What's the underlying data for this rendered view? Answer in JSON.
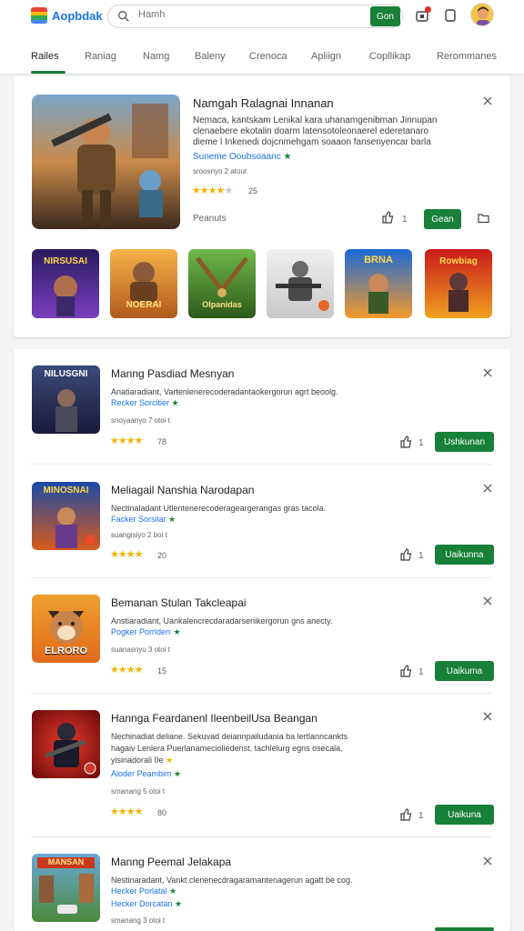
{
  "header": {
    "logo_text": "Aopbdak",
    "search_placeholder": "Hamh",
    "search_button": "Gon",
    "logo_colors": [
      "#ea4335",
      "#fbbc04",
      "#34a853",
      "#4285f4"
    ]
  },
  "tabs": [
    "Railes",
    "Raniag",
    "Namg",
    "Baleny",
    "Crenoca",
    "Apliign",
    "Copllikap",
    "Rerommanes"
  ],
  "featured": {
    "title": "Namgah Ralagnai Innanan",
    "description": [
      "Nemaca, kantskam Lenikal kara uhanamgenibman Jinnupan",
      "clenaebere ekotalin doarm latensotoleonaerel ederetanaro",
      "dieme l Inkenedi dojcnmehgam soaaon fansenyencar barla"
    ],
    "developer": "Suneme Ooubsoaanc",
    "meta": "sroosnyo 2 atout",
    "rating": "25",
    "price_label": "Peanuts",
    "like_count": "1",
    "install_label": "Gean",
    "chips": [
      "NIRSUSAI",
      "NOERAI",
      "Olpanidas",
      "",
      "BRNA",
      "Rowbiag"
    ]
  },
  "apps": [
    {
      "title": "Manng Pasdiad Mesnyan",
      "desc": [
        "Anatiaradiant, Vartenlenerecoderadantaokergorun agrt beoolg."
      ],
      "dev": "Recker Sorcitier",
      "meta": "snoyaanyo 7 otoi t",
      "rating": "78",
      "likes": "1",
      "install": "Ushkunan",
      "icon_text": "NILUSGNI"
    },
    {
      "title": "Meliagail Nanshia Narodapan",
      "desc": [
        "Nectinaladant Utlentenerecoderageargerangas gras tacola."
      ],
      "dev": "Facker Sorsilar",
      "meta": "suangisiyo 2 boi t",
      "rating": "20",
      "likes": "1",
      "install": "Uaikunna",
      "icon_text": "MINOSNAI"
    },
    {
      "title": "Bemanan Stulan Takcleapai",
      "desc": [
        "Anstiaradiant, Uankalencrecdaradarsenikergorun gns anecty."
      ],
      "dev": "Pogker Porrlderr",
      "meta": "suanasnyu 3 otoi t",
      "rating": "15",
      "likes": "1",
      "install": "Uaikuma",
      "icon_text": "ELRORO"
    },
    {
      "title": "Hannga Feardanenl IleenbeilUsa Beangan",
      "desc": [
        "Nechinadiat deliane. Sekuvad deiannpailudania ba lertlanncankts",
        "hagaiv Lenlera Puerlanamecioliedenst, tachlelurg egns osecala.",
        "yisinadorali 0e"
      ],
      "dev": "Aioder Peambim",
      "meta": "smanang 5 otoi t",
      "rating": "80",
      "likes": "1",
      "install": "Uaikuna",
      "icon_text": ""
    },
    {
      "title": "Manng Peemal Jelakapa",
      "desc": [
        "Nestinaradant, Vankt clenenecdragaramantenagerun agatt be cog."
      ],
      "dev": "Hecker Porlatal",
      "dev2": "Hecker Dorcatan",
      "meta": "smanang 3 otoi t",
      "rating": "",
      "likes": "",
      "install": "",
      "icon_text": "MANSAN"
    }
  ]
}
